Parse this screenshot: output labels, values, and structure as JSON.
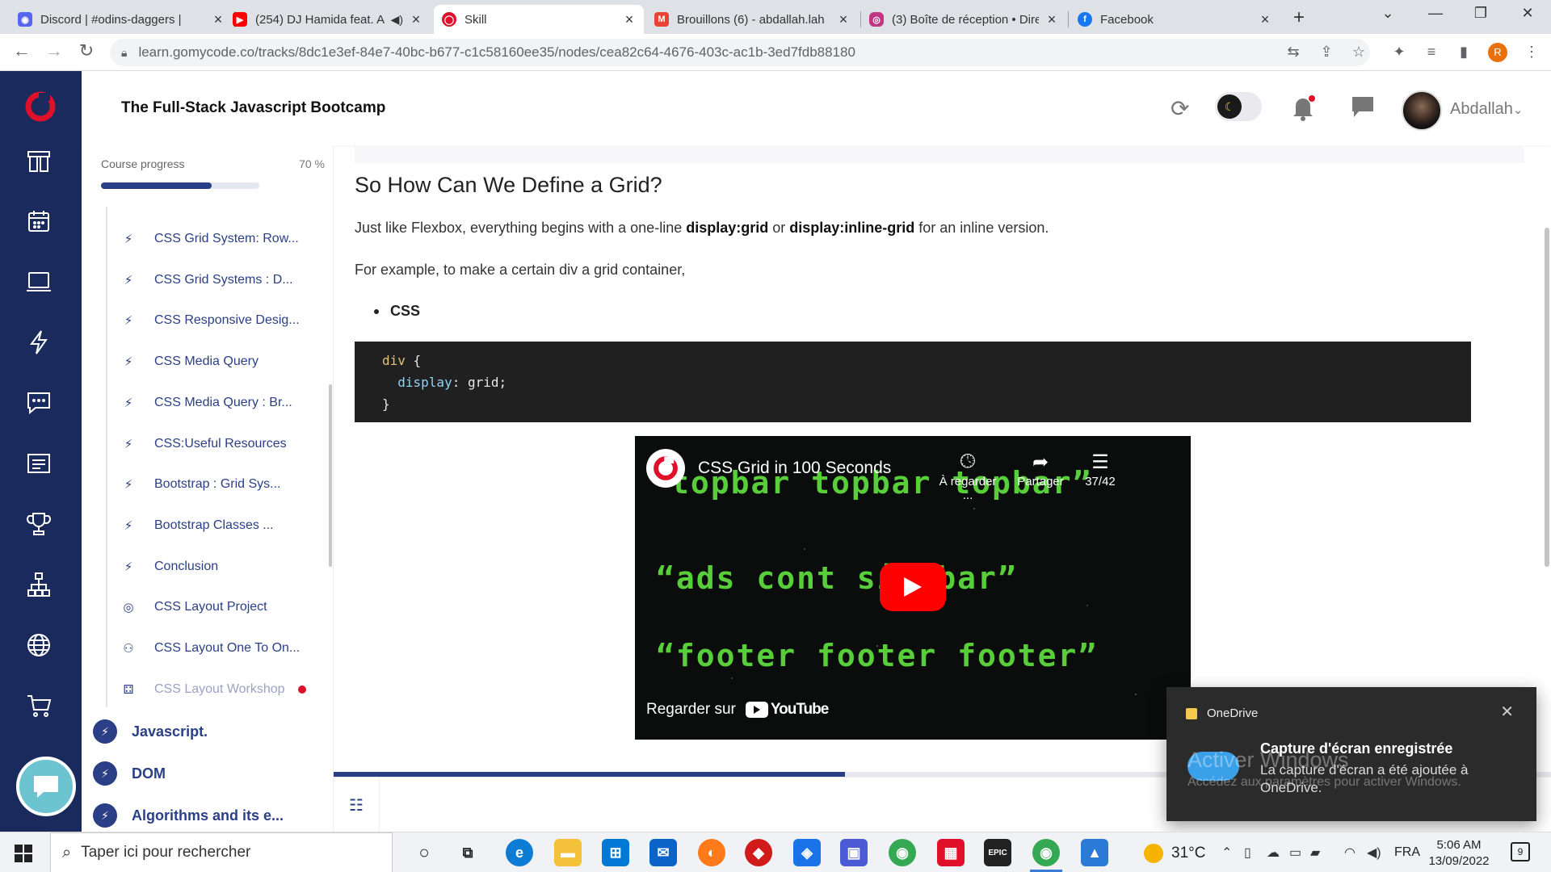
{
  "browser": {
    "tabs": [
      {
        "title": "Discord | #odins-daggers |",
        "icon": "discord-icon",
        "color": "#5865f2"
      },
      {
        "title": "(254) DJ Hamida feat. A",
        "icon": "youtube-icon",
        "color": "#ff0000"
      },
      {
        "title": "Skill",
        "icon": "gomycode-icon",
        "color": "#e0102a",
        "active": true
      },
      {
        "title": "Brouillons (6) - abdallah.lah",
        "icon": "gmail-icon",
        "color": "#ea4335"
      },
      {
        "title": "(3) Boîte de réception • Dire",
        "icon": "instagram-icon",
        "color": "#c13584"
      },
      {
        "title": "Facebook",
        "icon": "facebook-icon",
        "color": "#1877f2"
      }
    ],
    "url": "learn.gomycode.co/tracks/8dc1e3ef-84e7-40bc-b677-c1c58160ee35/nodes/cea82c64-4676-403c-ac1b-3ed7fdb88180",
    "profile_initial": "R"
  },
  "header": {
    "course_title": "The Full-Stack Javascript Bootcamp",
    "user_name": "Abdallah"
  },
  "sidebar": {
    "progress_label": "Course progress",
    "progress_percent_text": "70 %",
    "progress_value": 0.7,
    "lessons": [
      {
        "label": "CSS Grid System: Row...",
        "icon": "bolt-icon"
      },
      {
        "label": "CSS Grid Systems : D...",
        "icon": "bolt-icon"
      },
      {
        "label": "CSS Responsive Desig...",
        "icon": "bolt-icon"
      },
      {
        "label": "CSS Media Query",
        "icon": "bolt-icon"
      },
      {
        "label": "CSS Media Query : Br...",
        "icon": "bolt-icon"
      },
      {
        "label": "CSS:Useful Resources",
        "icon": "bolt-icon"
      },
      {
        "label": "Bootstrap : Grid Sys...",
        "icon": "bolt-icon"
      },
      {
        "label": "Bootstrap Classes ...",
        "icon": "bolt-icon"
      },
      {
        "label": "Conclusion",
        "icon": "bolt-icon"
      },
      {
        "label": "CSS Layout Project",
        "icon": "target-icon"
      },
      {
        "label": "CSS Layout One To On...",
        "icon": "people-icon"
      },
      {
        "label": "CSS Layout Workshop",
        "icon": "workshop-icon",
        "muted": true,
        "dot": true
      }
    ],
    "modules": [
      {
        "label": "Javascript."
      },
      {
        "label": "DOM"
      },
      {
        "label": "Algorithms and its e..."
      }
    ]
  },
  "content": {
    "heading": "So How Can We Define a Grid?",
    "para1": {
      "pre": "Just like Flexbox, everything begins with a one-line ",
      "b1": "display:grid",
      "mid": " or ",
      "b2": "display:inline-grid",
      "post": " for an inline version."
    },
    "para2": "For example, to make a certain div a grid container,",
    "bullet": "CSS",
    "code": {
      "selector": "div",
      "open": " {",
      "property": "display",
      "value": ": grid;",
      "close": "}"
    },
    "video": {
      "title": "CSS Grid in 100 Seconds",
      "watch_later": "À regarder ...",
      "share": "Partager",
      "playlist": "37/42",
      "watch_on": "Regarder sur",
      "brand": "YouTube",
      "frame_words": [
        "topbar topbar topbar”",
        "“ads  cont   sidebar”",
        "“footer  footer  footer”"
      ]
    },
    "reading_progress": 0.42
  },
  "toast": {
    "app": "OneDrive",
    "title": "Capture d'écran enregistrée",
    "body": "La capture d'écran a été ajoutée à OneDrive.",
    "watermark_title": "Activer Windows",
    "watermark_body": "Accédez aux paramètres pour activer Windows."
  },
  "taskbar": {
    "search_placeholder": "Taper ici pour rechercher",
    "temperature": "31°C",
    "language": "FRA",
    "time": "5:06 AM",
    "date": "13/09/2022",
    "notification_count": "9"
  }
}
